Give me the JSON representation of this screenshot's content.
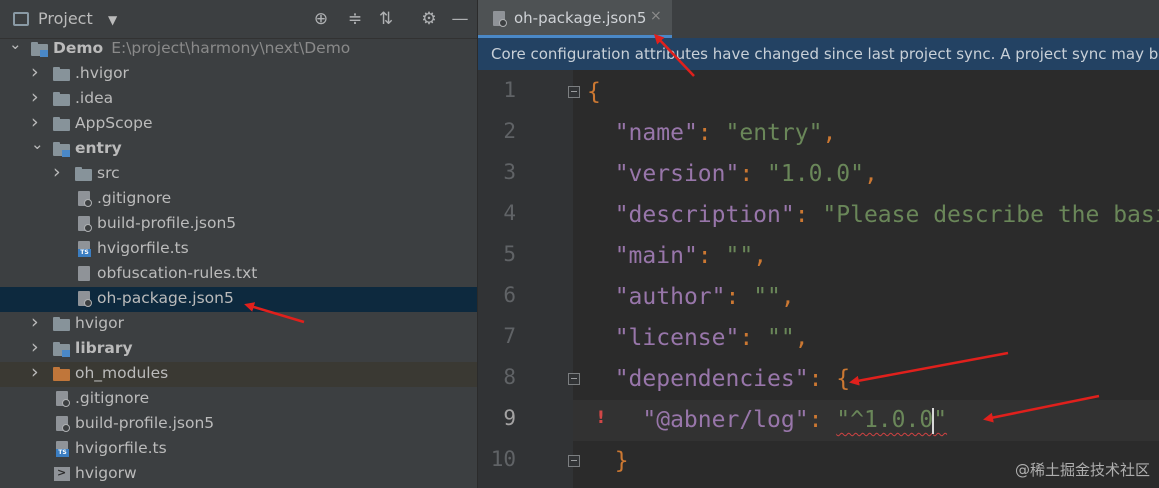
{
  "project_panel": {
    "title": "Project",
    "dropdown": "▼",
    "tree": [
      {
        "label": "Demo",
        "path": "E:\\project\\harmony\\next\\Demo",
        "type": "module-folder",
        "bold": true,
        "expanded": true
      },
      {
        "label": ".hvigor",
        "type": "folder",
        "expanded": false
      },
      {
        "label": ".idea",
        "type": "folder",
        "expanded": false
      },
      {
        "label": "AppScope",
        "type": "folder",
        "expanded": false
      },
      {
        "label": "entry",
        "type": "module-folder",
        "bold": true,
        "expanded": true
      },
      {
        "label": "src",
        "type": "folder",
        "expanded": false
      },
      {
        "label": ".gitignore",
        "type": "file-ignore"
      },
      {
        "label": "build-profile.json5",
        "type": "file-json"
      },
      {
        "label": "hvigorfile.ts",
        "type": "file-ts"
      },
      {
        "label": "obfuscation-rules.txt",
        "type": "file-txt"
      },
      {
        "label": "oh-package.json5",
        "type": "file-json",
        "selected": true
      },
      {
        "label": "hvigor",
        "type": "folder",
        "expanded": false
      },
      {
        "label": "library",
        "type": "module-folder",
        "bold": true,
        "expanded": false
      },
      {
        "label": "oh_modules",
        "type": "folder-orange",
        "expanded": false
      },
      {
        "label": ".gitignore",
        "type": "file-ignore"
      },
      {
        "label": "build-profile.json5",
        "type": "file-json"
      },
      {
        "label": "hvigorfile.ts",
        "type": "file-ts"
      },
      {
        "label": "hvigorw",
        "type": "file-exec"
      }
    ]
  },
  "editor": {
    "tab_label": "oh-package.json5",
    "tab_close": "×",
    "notice": "Core configuration attributes have changed since last project sync. A project sync may be necessary for the IDE to work properly.",
    "line_numbers": [
      "1",
      "2",
      "3",
      "4",
      "5",
      "6",
      "7",
      "8",
      "9",
      "10"
    ],
    "lines": [
      [
        {
          "t": "p",
          "v": "{"
        }
      ],
      [
        {
          "t": "w",
          "v": "  "
        },
        {
          "t": "k",
          "v": "\"name\""
        },
        {
          "t": "p",
          "v": ": "
        },
        {
          "t": "s",
          "v": "\"entry\""
        },
        {
          "t": "p",
          "v": ","
        }
      ],
      [
        {
          "t": "w",
          "v": "  "
        },
        {
          "t": "k",
          "v": "\"version\""
        },
        {
          "t": "p",
          "v": ": "
        },
        {
          "t": "s",
          "v": "\"1.0.0\""
        },
        {
          "t": "p",
          "v": ","
        }
      ],
      [
        {
          "t": "w",
          "v": "  "
        },
        {
          "t": "k",
          "v": "\"description\""
        },
        {
          "t": "p",
          "v": ": "
        },
        {
          "t": "s",
          "v": "\"Please describe the basic information.\""
        },
        {
          "t": "p",
          "v": ","
        }
      ],
      [
        {
          "t": "w",
          "v": "  "
        },
        {
          "t": "k",
          "v": "\"main\""
        },
        {
          "t": "p",
          "v": ": "
        },
        {
          "t": "s",
          "v": "\"\""
        },
        {
          "t": "p",
          "v": ","
        }
      ],
      [
        {
          "t": "w",
          "v": "  "
        },
        {
          "t": "k",
          "v": "\"author\""
        },
        {
          "t": "p",
          "v": ": "
        },
        {
          "t": "s",
          "v": "\"\""
        },
        {
          "t": "p",
          "v": ","
        }
      ],
      [
        {
          "t": "w",
          "v": "  "
        },
        {
          "t": "k",
          "v": "\"license\""
        },
        {
          "t": "p",
          "v": ": "
        },
        {
          "t": "s",
          "v": "\"\""
        },
        {
          "t": "p",
          "v": ","
        }
      ],
      [
        {
          "t": "w",
          "v": "  "
        },
        {
          "t": "k",
          "v": "\"dependencies\""
        },
        {
          "t": "p",
          "v": ": {"
        }
      ],
      [
        {
          "t": "w",
          "v": "    "
        },
        {
          "t": "k",
          "v": "\"@abner/log\""
        },
        {
          "t": "p",
          "v": ": "
        },
        {
          "t": "sq",
          "v": "\"^1.0.0"
        },
        {
          "t": "caret",
          "v": ""
        },
        {
          "t": "sq",
          "v": "\""
        }
      ],
      [
        {
          "t": "w",
          "v": "  "
        },
        {
          "t": "p",
          "v": "}"
        }
      ]
    ]
  },
  "watermark": "@稀土掘金技术社区",
  "colors": {
    "panel_bg": "#3c3f41",
    "editor_bg": "#2b2b2b",
    "selection": "#0d293e",
    "notice_bg": "#234263",
    "key": "#9876aa",
    "string": "#6a8759",
    "arrow": "#e0201c"
  }
}
